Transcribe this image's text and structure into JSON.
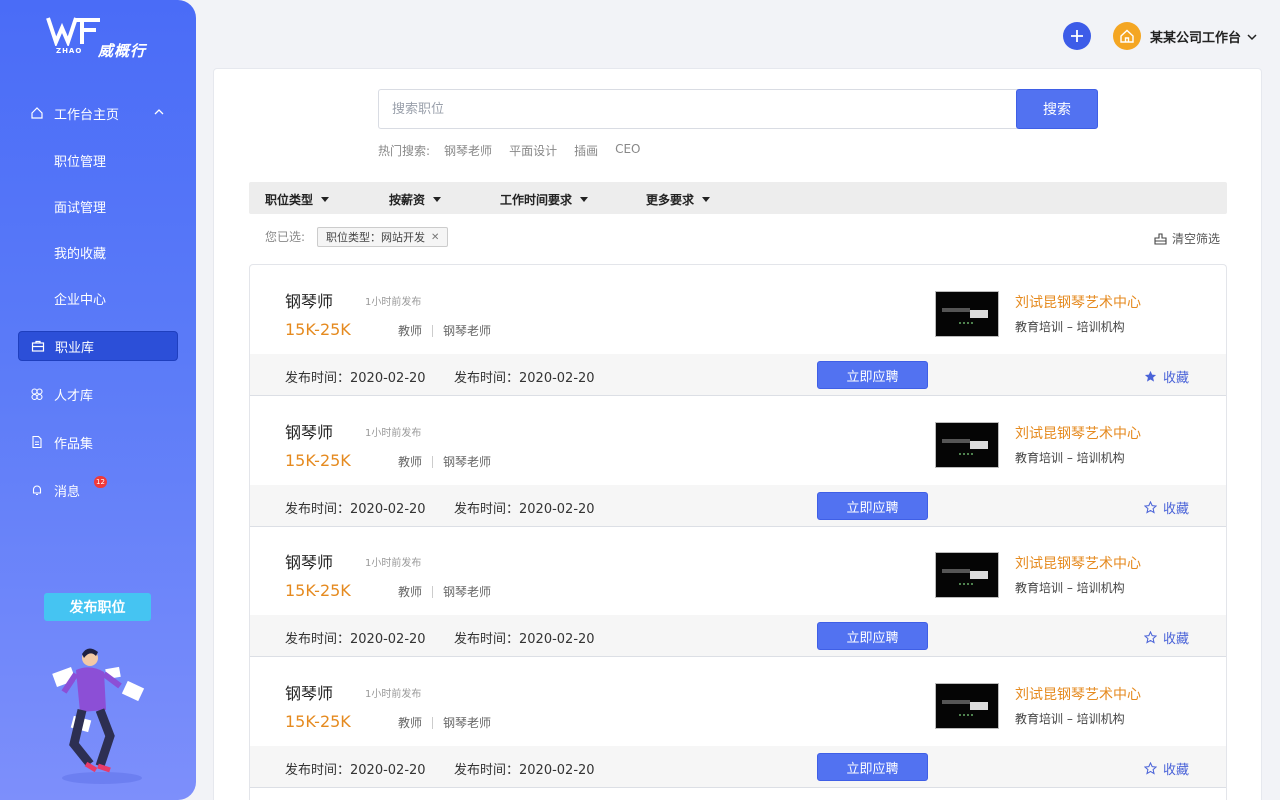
{
  "brand": {
    "name": "威概行",
    "sub": "ZHAO"
  },
  "sidebar": {
    "items": [
      {
        "label": "工作台主页"
      },
      {
        "label": "职位管理"
      },
      {
        "label": "面试管理"
      },
      {
        "label": "我的收藏"
      },
      {
        "label": "企业中心"
      },
      {
        "label": "职业库"
      },
      {
        "label": "人才库"
      },
      {
        "label": "作品集"
      },
      {
        "label": "消息",
        "badge": "12"
      }
    ],
    "publish_label": "发布职位"
  },
  "header": {
    "workspace": "某某公司工作台"
  },
  "search": {
    "placeholder": "搜索职位",
    "button": "搜索",
    "hot_label": "热门搜索:",
    "hot_keywords": [
      "钢琴老师",
      "平面设计",
      "插画",
      "CEO"
    ]
  },
  "filters": {
    "items": [
      "职位类型",
      "按薪资",
      "工作时间要求",
      "更多要求"
    ],
    "selected_label": "您已选:",
    "selected_tag": "职位类型：网站开发",
    "clear_label": "清空筛选"
  },
  "jobs": [
    {
      "title": "钢琴师",
      "posted": "1小时前发布",
      "salary": "15K-25K",
      "role": "教师",
      "category": "钢琴老师",
      "org": "刘试昆钢琴艺术中心",
      "org_type": "教育培训 – 培训机构",
      "date1": "发布时间：2020-02-20",
      "date2": "发布时间：2020-02-20",
      "apply": "立即应聘",
      "fav": "收藏",
      "favorited": true
    },
    {
      "title": "钢琴师",
      "posted": "1小时前发布",
      "salary": "15K-25K",
      "role": "教师",
      "category": "钢琴老师",
      "org": "刘试昆钢琴艺术中心",
      "org_type": "教育培训 – 培训机构",
      "date1": "发布时间：2020-02-20",
      "date2": "发布时间：2020-02-20",
      "apply": "立即应聘",
      "fav": "收藏",
      "favorited": false
    },
    {
      "title": "钢琴师",
      "posted": "1小时前发布",
      "salary": "15K-25K",
      "role": "教师",
      "category": "钢琴老师",
      "org": "刘试昆钢琴艺术中心",
      "org_type": "教育培训 – 培训机构",
      "date1": "发布时间：2020-02-20",
      "date2": "发布时间：2020-02-20",
      "apply": "立即应聘",
      "fav": "收藏",
      "favorited": false
    },
    {
      "title": "钢琴师",
      "posted": "1小时前发布",
      "salary": "15K-25K",
      "role": "教师",
      "category": "钢琴老师",
      "org": "刘试昆钢琴艺术中心",
      "org_type": "教育培训 – 培训机构",
      "date1": "发布时间：2020-02-20",
      "date2": "发布时间：2020-02-20",
      "apply": "立即应聘",
      "fav": "收藏",
      "favorited": false
    }
  ],
  "colors": {
    "accent": "#5272f1",
    "orange": "#e58a1f",
    "sidebar_top": "#4a6cf7",
    "badge": "#f03a3a"
  }
}
